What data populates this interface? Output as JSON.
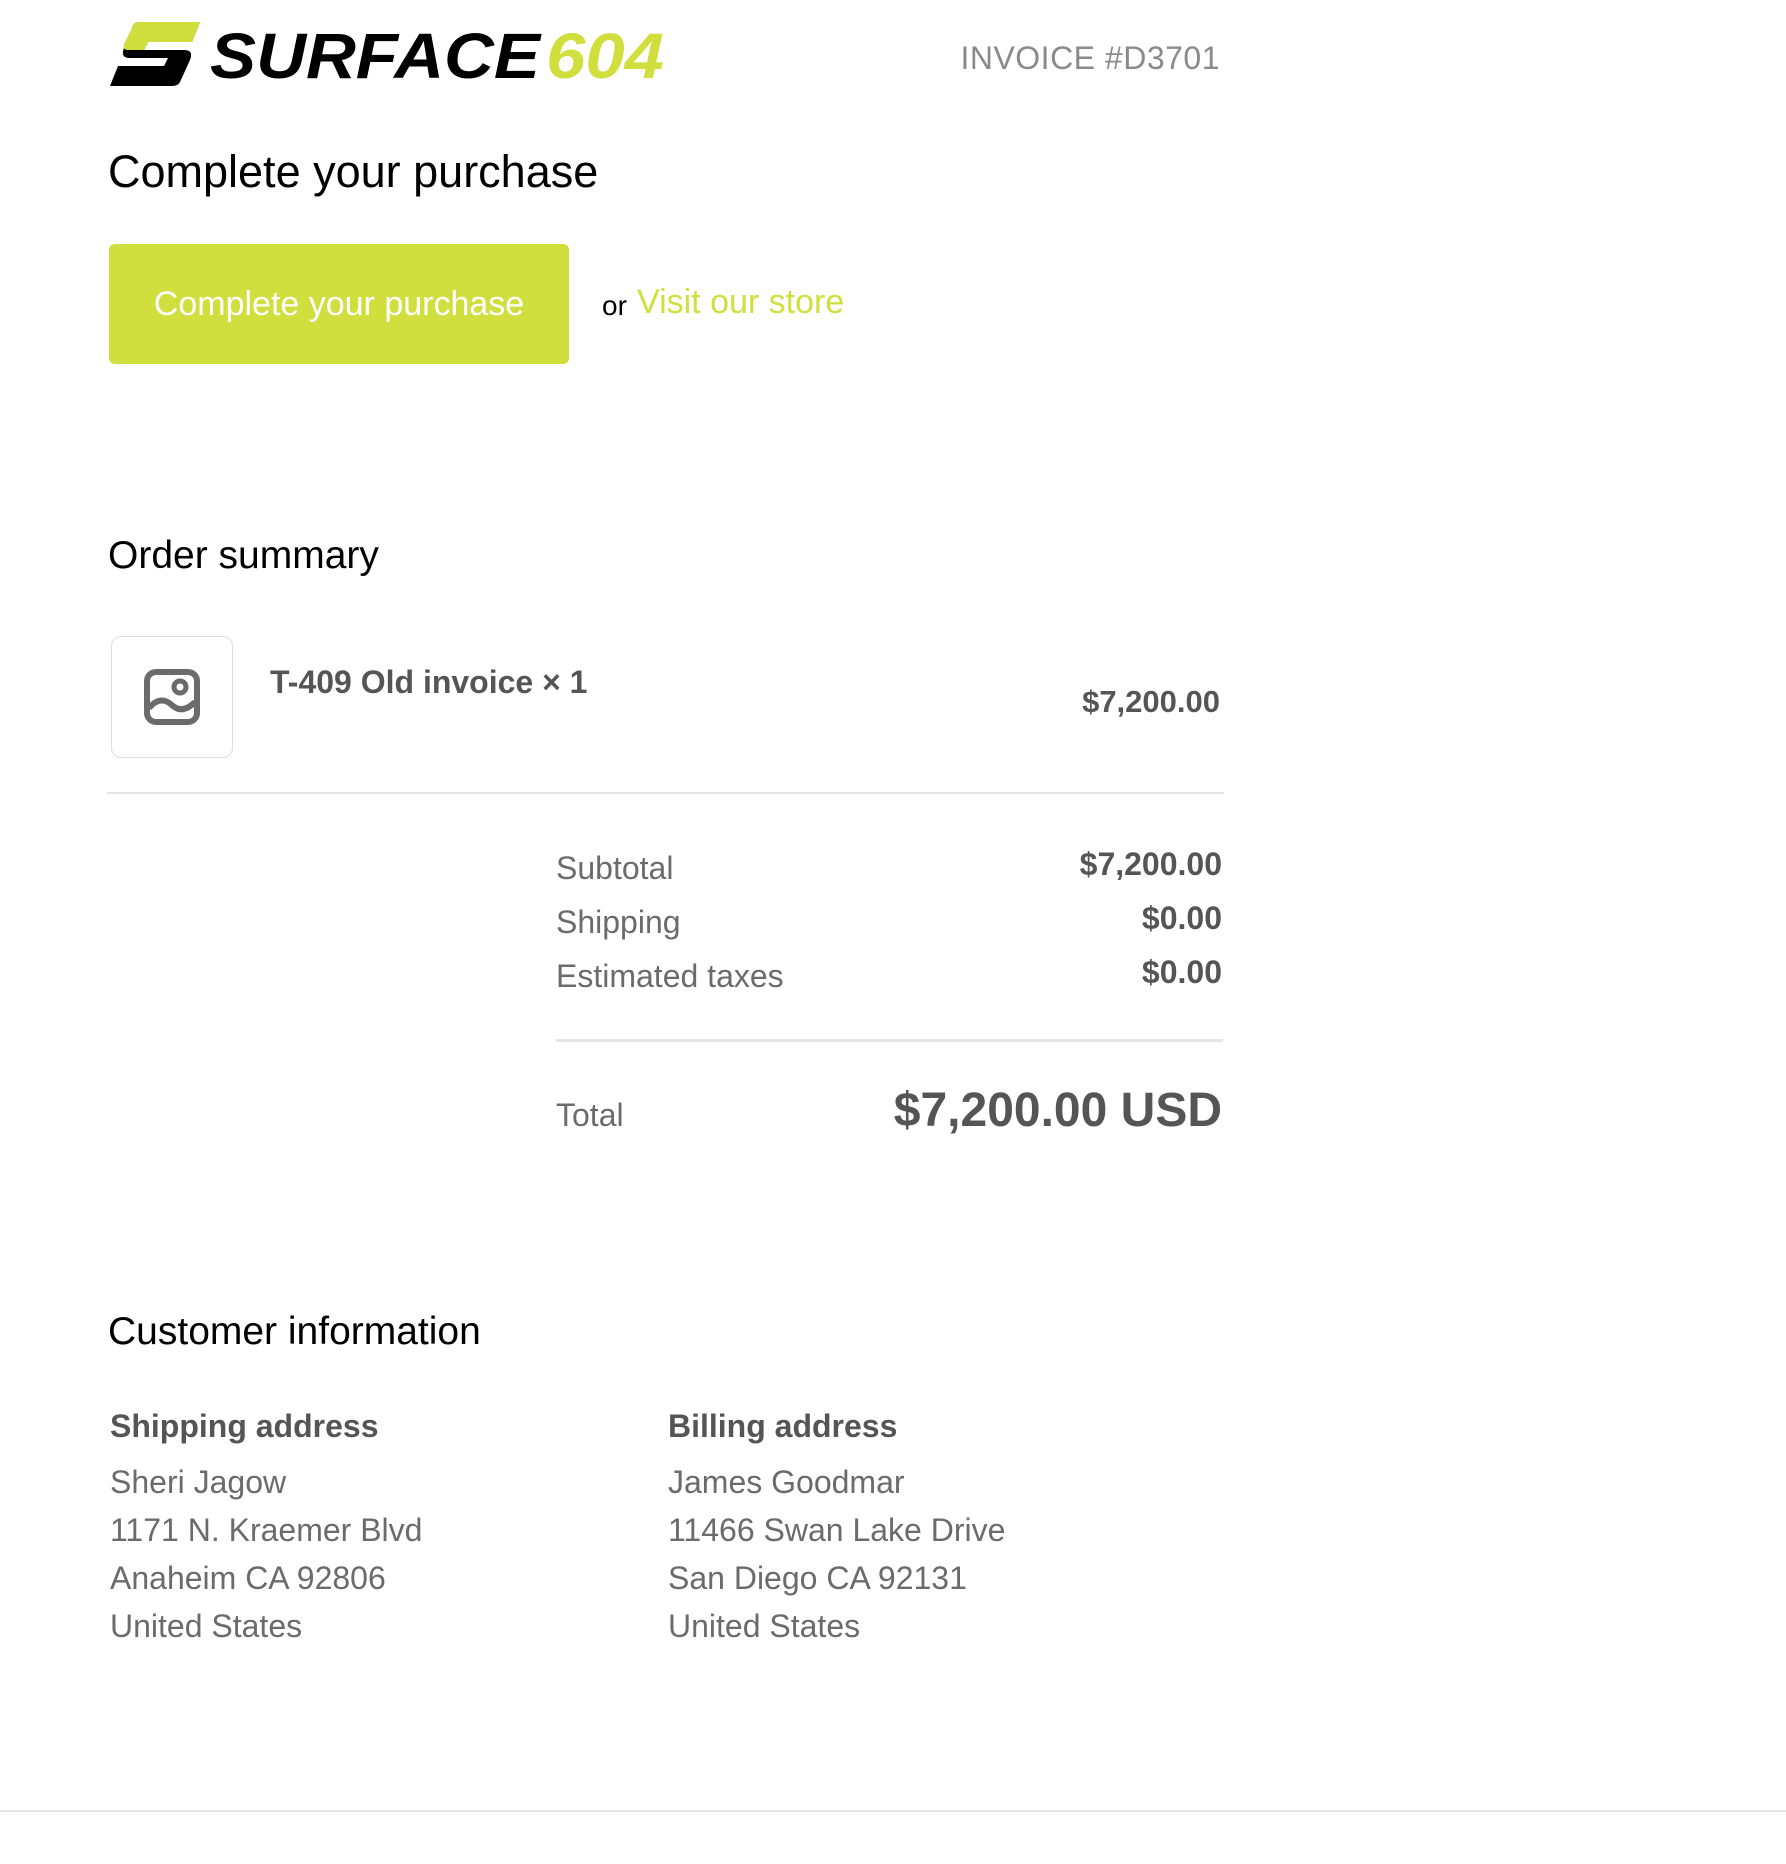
{
  "header": {
    "brand_word": "SURFACE",
    "brand_number": "604",
    "invoice_number": "INVOICE #D3701"
  },
  "colors": {
    "accent": "#d1df3e",
    "text_dark": "#000000",
    "text_muted": "#6b6b6b",
    "text_value": "#555555"
  },
  "page": {
    "title": "Complete your purchase",
    "cta_label": "Complete your purchase",
    "or_text": "or",
    "store_link": "Visit our store"
  },
  "order_summary": {
    "title": "Order summary",
    "items": [
      {
        "name": "T-409 Old invoice × 1",
        "price": "$7,200.00",
        "thumbnail_icon": "image-placeholder-icon"
      }
    ],
    "subtotal_label": "Subtotal",
    "subtotal_value": "$7,200.00",
    "shipping_label": "Shipping",
    "shipping_value": "$0.00",
    "taxes_label": "Estimated taxes",
    "taxes_value": "$0.00",
    "total_label": "Total",
    "total_value": "$7,200.00 USD"
  },
  "customer": {
    "title": "Customer information",
    "shipping_address": {
      "heading": "Shipping address",
      "lines": [
        "Sheri Jagow",
        "1171 N. Kraemer Blvd",
        "Anaheim CA 92806",
        "United States"
      ]
    },
    "billing_address": {
      "heading": "Billing address",
      "lines": [
        "James Goodmar",
        "11466 Swan Lake Drive",
        "San Diego CA 92131",
        "United States"
      ]
    }
  }
}
